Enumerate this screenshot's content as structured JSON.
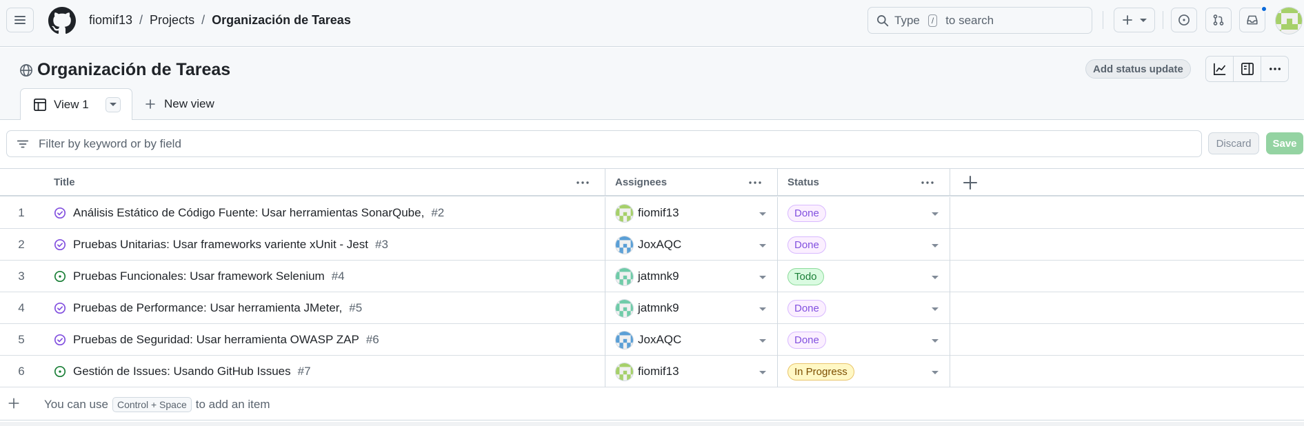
{
  "header": {
    "breadcrumb": [
      "fiomif13",
      "Projects",
      "Organización de Tareas"
    ],
    "breadcrumb_separator": "/",
    "search": {
      "prefix": "Type",
      "key": "/",
      "suffix": "to search"
    }
  },
  "project": {
    "title": "Organización de Tareas",
    "status_button": "Add status update",
    "tabs": [
      {
        "label": "View 1"
      }
    ],
    "new_view_label": "New view"
  },
  "filter": {
    "placeholder": "Filter by keyword or by field",
    "discard_label": "Discard",
    "save_label": "Save"
  },
  "table": {
    "columns": [
      "Title",
      "Assignees",
      "Status"
    ],
    "rows": [
      {
        "n": "1",
        "title": "Análisis Estático de Código Fuente: Usar herramientas SonarQube,",
        "issue": "#2",
        "state": "closed",
        "assignee": "fiomif13",
        "avatar": "green",
        "status": "Done"
      },
      {
        "n": "2",
        "title": "Pruebas Unitarias: Usar frameworks variente xUnit - Jest",
        "issue": "#3",
        "state": "closed",
        "assignee": "JoxAQC",
        "avatar": "blue",
        "status": "Done"
      },
      {
        "n": "3",
        "title": "Pruebas Funcionales: Usar framework Selenium",
        "issue": "#4",
        "state": "open",
        "assignee": "jatmnk9",
        "avatar": "teal",
        "status": "Todo"
      },
      {
        "n": "4",
        "title": "Pruebas de Performance: Usar herramienta JMeter,",
        "issue": "#5",
        "state": "closed",
        "assignee": "jatmnk9",
        "avatar": "teal",
        "status": "Done"
      },
      {
        "n": "5",
        "title": "Pruebas de Seguridad: Usar herramienta OWASP ZAP",
        "issue": "#6",
        "state": "closed",
        "assignee": "JoxAQC",
        "avatar": "blue",
        "status": "Done"
      },
      {
        "n": "6",
        "title": "Gestión de Issues: Usando GitHub Issues",
        "issue": "#7",
        "state": "open",
        "assignee": "fiomif13",
        "avatar": "green",
        "status": "In Progress"
      }
    ],
    "add_item": {
      "prefix": "You can use",
      "shortcut": "Control + Space",
      "suffix": "to add an item"
    }
  },
  "colors": {
    "closed_icon": "#8250df",
    "open_icon": "#1a7f37",
    "done_bg": "#fbefff",
    "done_fg": "#8250df",
    "done_border": "#d8b9ff",
    "todo_bg": "#dafbe1",
    "todo_fg": "#1a7f37",
    "todo_border": "#8ddb9b",
    "progress_bg": "#fff8c5",
    "progress_fg": "#7d4e00",
    "progress_border": "#e9c46a"
  }
}
